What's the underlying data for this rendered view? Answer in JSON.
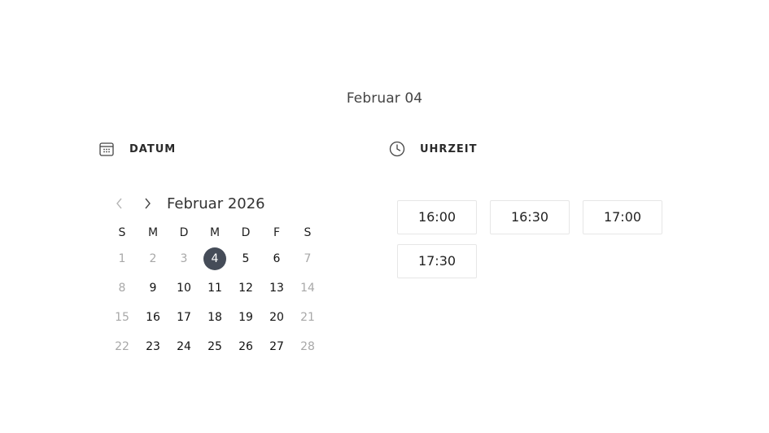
{
  "selected_date_title": "Februar 04",
  "date_section": {
    "label": "DATUM",
    "icon": "calendar-icon"
  },
  "time_section": {
    "label": "UHRZEIT",
    "icon": "clock-icon"
  },
  "calendar": {
    "month_label": "Februar 2026",
    "prev_icon": "chevron-left-icon",
    "next_icon": "chevron-right-icon",
    "weekdays": [
      "S",
      "M",
      "D",
      "M",
      "D",
      "F",
      "S"
    ],
    "weeks": [
      [
        "1",
        "2",
        "3",
        "4",
        "5",
        "6",
        "7"
      ],
      [
        "8",
        "9",
        "10",
        "11",
        "12",
        "13",
        "14"
      ],
      [
        "15",
        "16",
        "17",
        "18",
        "19",
        "20",
        "21"
      ],
      [
        "22",
        "23",
        "24",
        "25",
        "26",
        "27",
        "28"
      ]
    ],
    "selected_day": "4",
    "disabled_days": [
      "1",
      "2",
      "3",
      "7",
      "8",
      "14",
      "15",
      "21",
      "22",
      "28"
    ]
  },
  "time_slots": [
    "16:00",
    "16:30",
    "17:00",
    "17:30"
  ],
  "colors": {
    "selected_day_bg": "#454c58",
    "muted_text": "#a8a8a8",
    "slot_border": "#e6e6e6"
  }
}
